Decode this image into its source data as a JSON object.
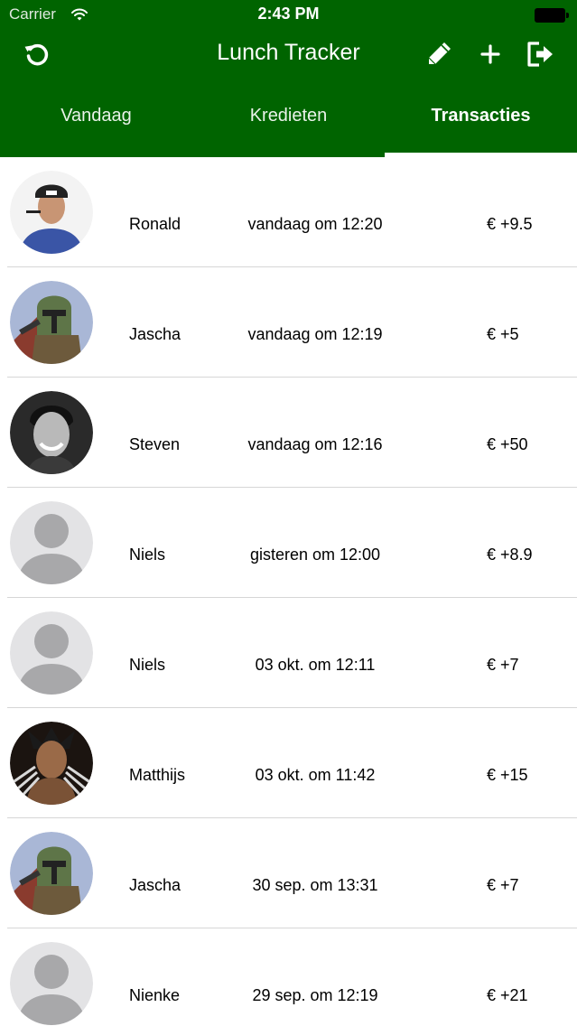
{
  "status_bar": {
    "carrier": "Carrier",
    "time": "2:43 PM",
    "wifi_icon": "wifi-icon",
    "battery_icon": "battery-icon"
  },
  "nav": {
    "title": "Lunch Tracker",
    "background": "#006400",
    "left_icon": "refresh-icon",
    "right_icons": [
      "pencil-icon",
      "plus-icon",
      "logout-icon"
    ]
  },
  "tabs": [
    {
      "label": "Vandaag",
      "active": false
    },
    {
      "label": "Kredieten",
      "active": false
    },
    {
      "label": "Transacties",
      "active": true
    }
  ],
  "transactions": [
    {
      "name": "Ronald",
      "date": "vandaag om 12:20",
      "amount": "€ +9.5",
      "avatar": "photo-avatar"
    },
    {
      "name": "Jascha",
      "date": "vandaag om 12:19",
      "amount": "€ +5",
      "avatar": "photo-avatar"
    },
    {
      "name": "Steven",
      "date": "vandaag om 12:16",
      "amount": "€ +50",
      "avatar": "photo-avatar"
    },
    {
      "name": "Niels",
      "date": "gisteren om 12:00",
      "amount": "€ +8.9",
      "avatar": "placeholder-avatar"
    },
    {
      "name": "Niels",
      "date": "03 okt. om 12:11",
      "amount": "€ +7",
      "avatar": "placeholder-avatar"
    },
    {
      "name": "Matthijs",
      "date": "03 okt. om 11:42",
      "amount": "€ +15",
      "avatar": "photo-avatar"
    },
    {
      "name": "Jascha",
      "date": "30 sep. om 13:31",
      "amount": "€ +7",
      "avatar": "photo-avatar"
    },
    {
      "name": "Nienke",
      "date": "29 sep. om 12:19",
      "amount": "€ +21",
      "avatar": "placeholder-avatar"
    }
  ]
}
